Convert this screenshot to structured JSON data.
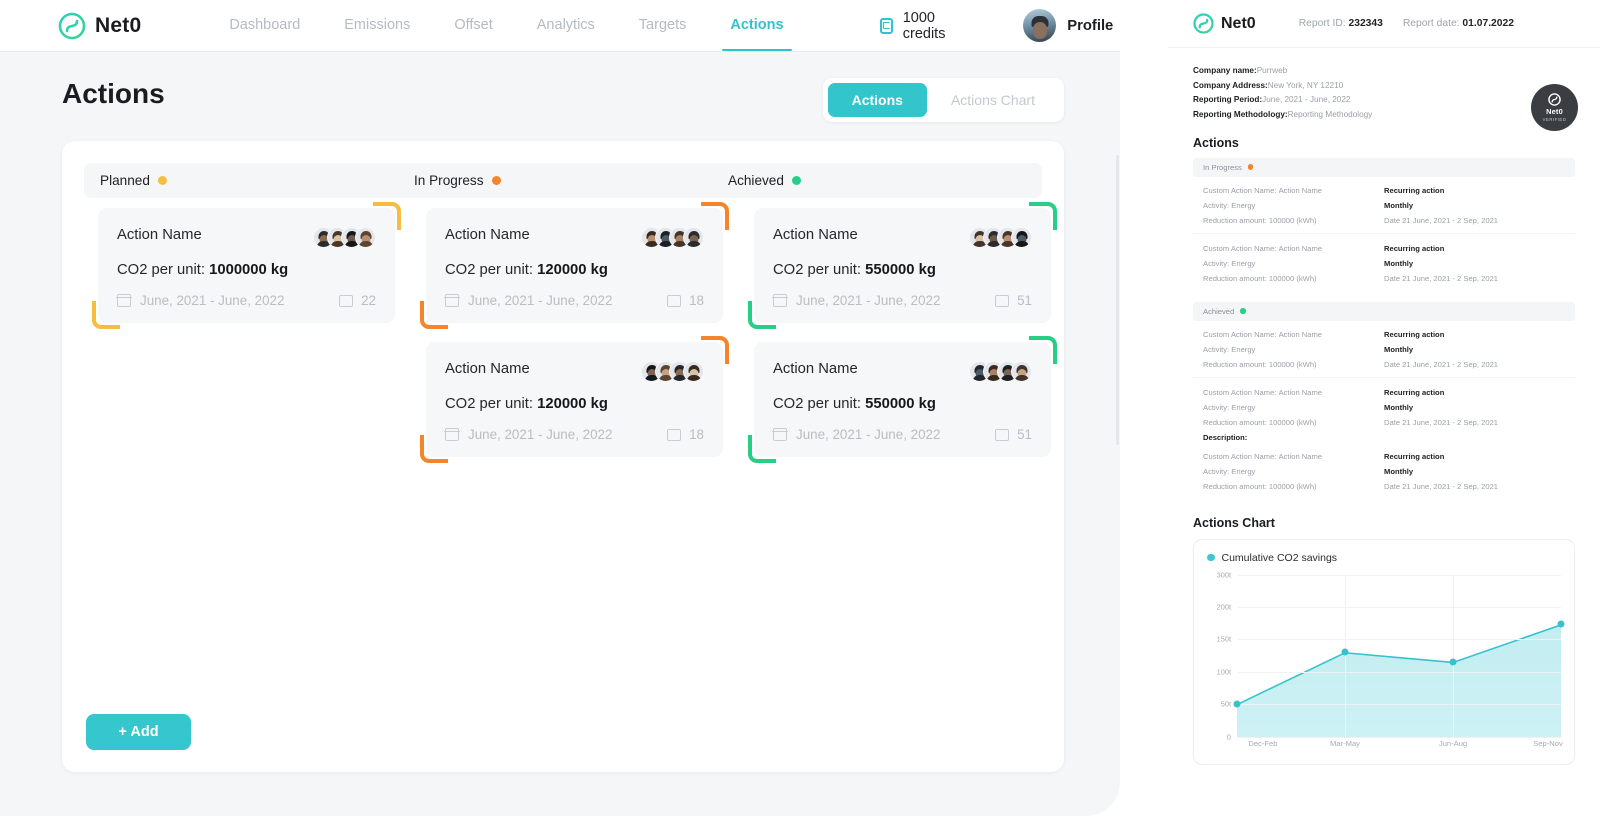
{
  "app": {
    "brand": "Net0",
    "nav": [
      {
        "label": "Dashboard",
        "active": false
      },
      {
        "label": "Emissions",
        "active": false
      },
      {
        "label": "Offset",
        "active": false
      },
      {
        "label": "Analytics",
        "active": false
      },
      {
        "label": "Targets",
        "active": false
      },
      {
        "label": "Actions",
        "active": true
      }
    ],
    "credits": "1000 credits",
    "profile": "Profile",
    "page_title": "Actions",
    "tabs": [
      {
        "label": "Actions",
        "active": true
      },
      {
        "label": "Actions Chart",
        "active": false
      }
    ],
    "add_button": "+ Add",
    "columns": [
      {
        "title": "Planned",
        "color": "#f7bd3f",
        "cards": [
          {
            "name": "Action Name",
            "co2_label": "CO2 per unit:",
            "co2_value": "1000000 kg",
            "period": "June, 2021 - June, 2022",
            "comments": "22",
            "members": 4
          }
        ]
      },
      {
        "title": "In Progress",
        "color": "#f5842c",
        "cards": [
          {
            "name": "Action Name",
            "co2_label": "CO2 per unit:",
            "co2_value": "120000 kg",
            "period": "June, 2021 - June, 2022",
            "comments": "18",
            "members": 4
          },
          {
            "name": "Action Name",
            "co2_label": "CO2 per unit:",
            "co2_value": "120000 kg",
            "period": "June, 2021 - June, 2022",
            "comments": "18",
            "members": 4
          }
        ]
      },
      {
        "title": "Achieved",
        "color": "#27cf86",
        "cards": [
          {
            "name": "Action Name",
            "co2_label": "CO2 per unit:",
            "co2_value": "550000 kg",
            "period": "June, 2021 - June, 2022",
            "comments": "51",
            "members": 4
          },
          {
            "name": "Action Name",
            "co2_label": "CO2 per unit:",
            "co2_value": "550000 kg",
            "period": "June, 2021 - June, 2022",
            "comments": "51",
            "members": 4
          }
        ]
      }
    ]
  },
  "report": {
    "brand": "Net0",
    "report_id_label": "Report ID:",
    "report_id": "232343",
    "report_date_label": "Report date:",
    "report_date": "01.07.2022",
    "company": [
      {
        "label": "Company name:",
        "value": "Purrweb"
      },
      {
        "label": "Company Address:",
        "value": "New York, NY 12210"
      },
      {
        "label": "Reporting Period:",
        "value": "June, 2021 - June, 2022"
      },
      {
        "label": "Reporting Methodology:",
        "value": "Reporting Methodology"
      }
    ],
    "badge": {
      "name": "Net0",
      "sub": "VERIFIED"
    },
    "actions_title": "Actions",
    "groups": [
      {
        "title": "In Progress",
        "color": "#f5842c",
        "entries": [
          {
            "name_label": "Custom Action Name:",
            "name": "Action Name",
            "activity_label": "Activity:",
            "activity": "Energy",
            "reduction_label": "Reduction amount:",
            "reduction": "100000 (kWh)",
            "recurring_title": "Recurring action",
            "recurring_value": "Monthly",
            "date_label": "Date",
            "date": "21 June, 2021 - 2 Sep, 2021",
            "description_label": ""
          },
          {
            "name_label": "Custom Action Name:",
            "name": "Action Name",
            "activity_label": "Activity:",
            "activity": "Energy",
            "reduction_label": "Reduction amount:",
            "reduction": "100000 (kWh)",
            "recurring_title": "Recurring action",
            "recurring_value": "Monthly",
            "date_label": "Date",
            "date": "21 June, 2021 - 2 Sep, 2021",
            "description_label": ""
          }
        ]
      },
      {
        "title": "Achieved",
        "color": "#27cf86",
        "entries": [
          {
            "name_label": "Custom Action Name:",
            "name": "Action Name",
            "activity_label": "Activity:",
            "activity": "Energy",
            "reduction_label": "Reduction amount:",
            "reduction": "100000 (kWh)",
            "recurring_title": "Recurring action",
            "recurring_value": "Monthly",
            "date_label": "Date",
            "date": "21 June, 2021 - 2 Sep, 2021",
            "description_label": ""
          },
          {
            "name_label": "Custom Action Name:",
            "name": "Action Name",
            "activity_label": "Activity:",
            "activity": "Energy",
            "reduction_label": "Reduction amount:",
            "reduction": "100000 (kWh)",
            "recurring_title": "Recurring action",
            "recurring_value": "Monthly",
            "date_label": "Date",
            "date": "21 June, 2021 - 2 Sep, 2021",
            "description_label": "Description:"
          },
          {
            "name_label": "Custom Action Name:",
            "name": "Action Name",
            "activity_label": "Activity:",
            "activity": "Energy",
            "reduction_label": "Reduction amount:",
            "reduction": "100000 (kWh)",
            "recurring_title": "Recurring action",
            "recurring_value": "Monthly",
            "date_label": "Date",
            "date": "21 June, 2021 - 2 Sep, 2021",
            "description_label": ""
          }
        ]
      }
    ],
    "chart_title": "Actions Chart"
  },
  "chart_data": {
    "type": "area",
    "title": "Actions Chart",
    "legend": [
      "Cumulative CO2 savings"
    ],
    "legend_position": "top-left",
    "series": [
      {
        "name": "Cumulative CO2 savings",
        "values": [
          50,
          130,
          115,
          173
        ],
        "color": "#35c2cd"
      }
    ],
    "categories": [
      "Dec-Feb",
      "Mar-May",
      "Jun-Aug",
      "Sep-Nov"
    ],
    "x": [
      "Dec-Feb",
      "Mar-May",
      "Jun-Aug",
      "Sep-Nov"
    ],
    "xlabel": "",
    "ylabel": "",
    "ytick_labels": [
      "300t",
      "200t",
      "150t",
      "100t",
      "50t",
      "0"
    ],
    "ytick_values": [
      300,
      200,
      150,
      100,
      50,
      0
    ],
    "ylim": [
      0,
      300
    ],
    "grid": true
  }
}
